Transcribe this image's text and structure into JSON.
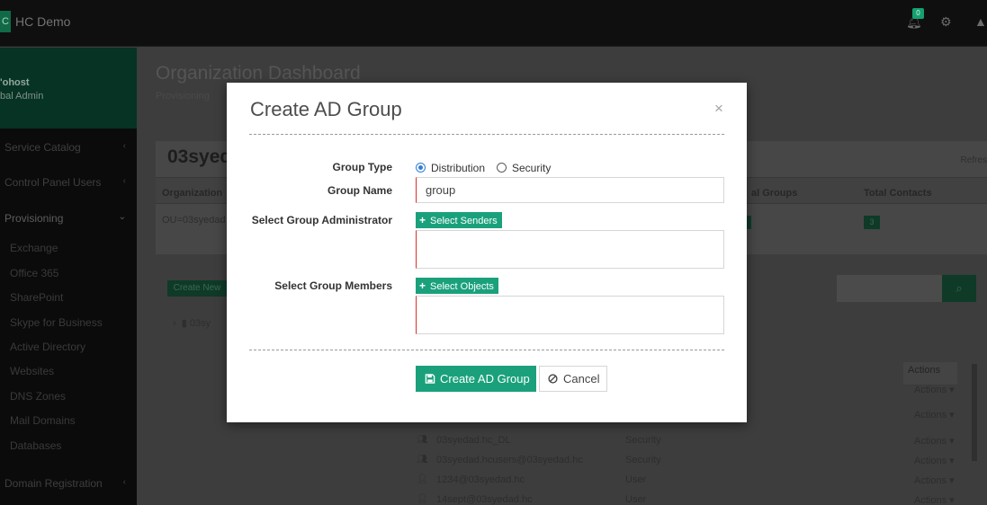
{
  "app": {
    "brand": "HC Demo",
    "brand_mark": "C",
    "notification_count": "0"
  },
  "sidebar": {
    "user_name": "'ohost",
    "user_role": "bal Admin",
    "items": [
      {
        "label": "Service Catalog"
      },
      {
        "label": "Control Panel Users"
      },
      {
        "label": "Provisioning"
      },
      {
        "label": "Domain Registration"
      }
    ],
    "sub_items": [
      {
        "label": "Exchange"
      },
      {
        "label": "Office 365"
      },
      {
        "label": "SharePoint"
      },
      {
        "label": "Skype for Business"
      },
      {
        "label": "Active Directory"
      },
      {
        "label": "Websites"
      },
      {
        "label": "DNS Zones"
      },
      {
        "label": "Mail Domains"
      },
      {
        "label": "Databases"
      }
    ]
  },
  "background": {
    "page_title": "Organization Dashboard",
    "breadcrumb": "Provisioning",
    "org_name": "03syed",
    "refresh": "Refres",
    "headers": [
      "Organization",
      "al Groups",
      "Total Contacts"
    ],
    "org_cell": "OU=03syedad",
    "chip_groups": "",
    "chip_contacts": "3",
    "create_new": "Create New",
    "tree_item": "03sy",
    "actions_header": "Actions",
    "rows": [
      {
        "name": "03syedad.hc_DL",
        "type": "Security",
        "action": "Actions"
      },
      {
        "name": "03syedad.hcusers@03syedad.hc",
        "type": "Security",
        "action": "Actions"
      },
      {
        "name": "1234@03syedad.hc",
        "type": "User",
        "action": "Actions"
      },
      {
        "name": "14sept@03syedad.hc",
        "type": "User",
        "action": "Actions"
      }
    ],
    "extra_actions": [
      "Actions",
      "Actions"
    ]
  },
  "modal": {
    "title": "Create AD Group",
    "close": "×",
    "group_type_label": "Group Type",
    "group_type_options": [
      {
        "label": "Distribution",
        "checked": true
      },
      {
        "label": "Security",
        "checked": false
      }
    ],
    "group_name_label": "Group Name",
    "group_name_value": "group",
    "admin_label": "Select Group Administrator",
    "select_senders": "Select Senders",
    "members_label": "Select Group Members",
    "select_objects": "Select Objects",
    "create_button": "Create AD Group",
    "cancel_button": "Cancel"
  },
  "colors": {
    "accent": "#1aa17c",
    "required_border": "#d9302a",
    "radio_selected": "#2f7fd3"
  }
}
